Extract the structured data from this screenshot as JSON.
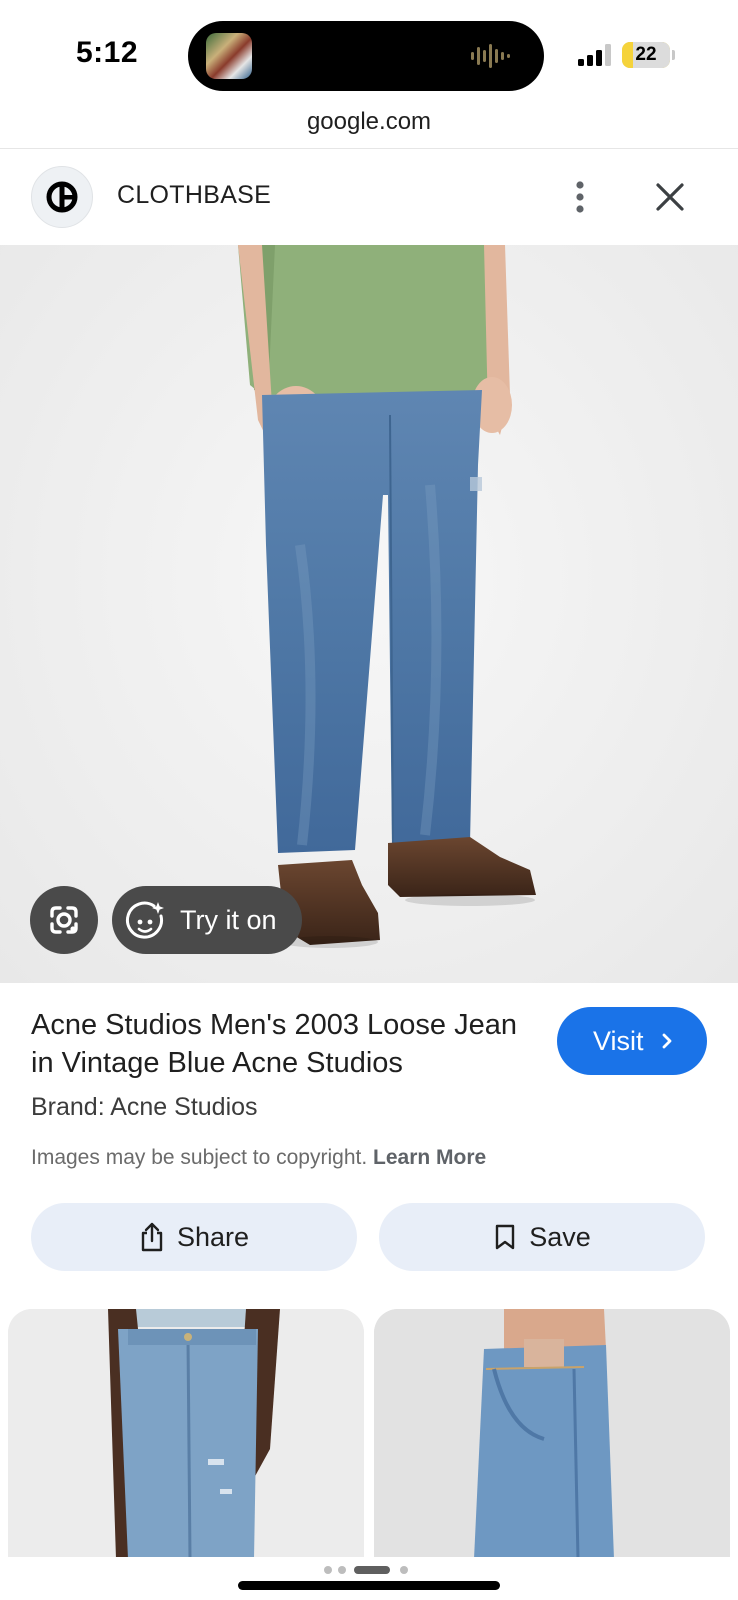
{
  "status_bar": {
    "time": "5:12",
    "battery_level": "22",
    "battery_fraction": 0.22
  },
  "browser": {
    "url": "google.com"
  },
  "header": {
    "site_name": "CLOTHBASE"
  },
  "hero": {
    "try_on_label": "Try it on"
  },
  "product": {
    "title": "Acne Studios Men's 2003 Loose Jean in Vintage Blue Acne Studios",
    "visit_label": "Visit",
    "brand": "Brand: Acne Studios",
    "copyright_text": "Images may be subject to copyright.",
    "learn_more_label": "Learn More"
  },
  "actions": {
    "share_label": "Share",
    "save_label": "Save"
  },
  "colors": {
    "accent": "#1a73e8",
    "action_button_bg": "#e8eef8",
    "overlay_button_bg": "#4a4a4a",
    "battery": "#f5d33b"
  },
  "icons": [
    "clothbase-logo-icon",
    "more-vert-icon",
    "close-icon",
    "google-lens-icon",
    "sparkle-face-icon",
    "chevron-right-icon",
    "share-icon",
    "bookmark-icon"
  ]
}
